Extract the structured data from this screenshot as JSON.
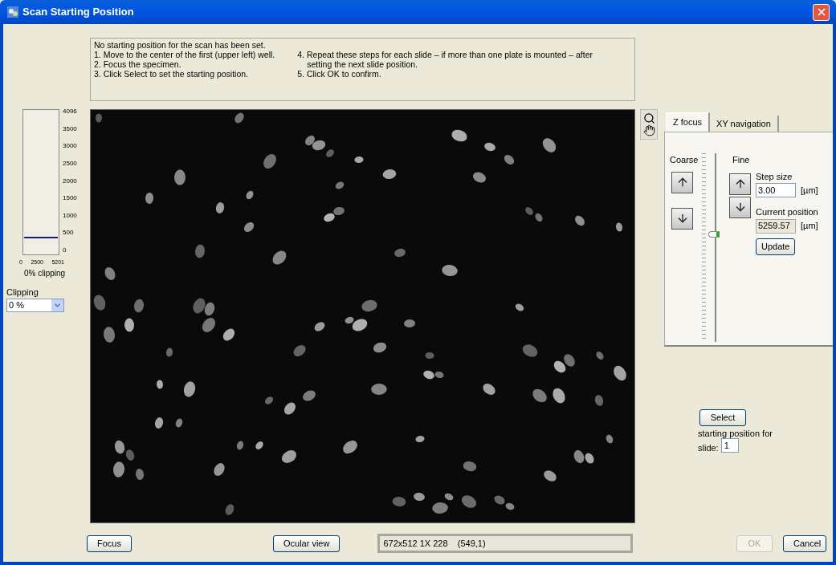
{
  "window": {
    "title": "Scan Starting Position"
  },
  "instructions": {
    "left": [
      "No starting position for the scan has been set.",
      "1. Move to the center of the first (upper left) well.",
      "2. Focus the specimen.",
      "3. Click Select to set the starting position."
    ],
    "right": [
      "4. Repeat these steps for each slide – if more than one plate is mounted – after setting the next slide position.",
      "5. Click OK to confirm."
    ]
  },
  "histogram": {
    "y_ticks": [
      "4096",
      "3500",
      "3000",
      "2500",
      "2000",
      "1500",
      "1000",
      "500",
      "0"
    ],
    "x_ticks": [
      "0",
      "2500",
      "5201"
    ],
    "caption": "0% clipping"
  },
  "clipping": {
    "label": "Clipping",
    "value": "0 %"
  },
  "tabs": [
    {
      "label": "Z focus",
      "selected": true
    },
    {
      "label": "XY navigation",
      "selected": false
    }
  ],
  "z_focus": {
    "coarse_label": "Coarse",
    "fine_label": "Fine",
    "slider": {
      "level": 0.57
    },
    "step_size": {
      "label": "Step size",
      "value": "3.00",
      "unit": "[µm]"
    },
    "current_position": {
      "label": "Current position",
      "value": "5259.57",
      "unit": "[µm]"
    },
    "update_button": "Update"
  },
  "select_button": "Select",
  "slide": {
    "label": "starting position for slide:",
    "value": "1"
  },
  "bottom": {
    "focus_button": "Focus",
    "ocular_button": "Ocular view",
    "status": "672x512 1X 228    (549,1)"
  },
  "ok_button": {
    "label": "OK",
    "disabled": true
  },
  "cancel_button": "Cancel"
}
